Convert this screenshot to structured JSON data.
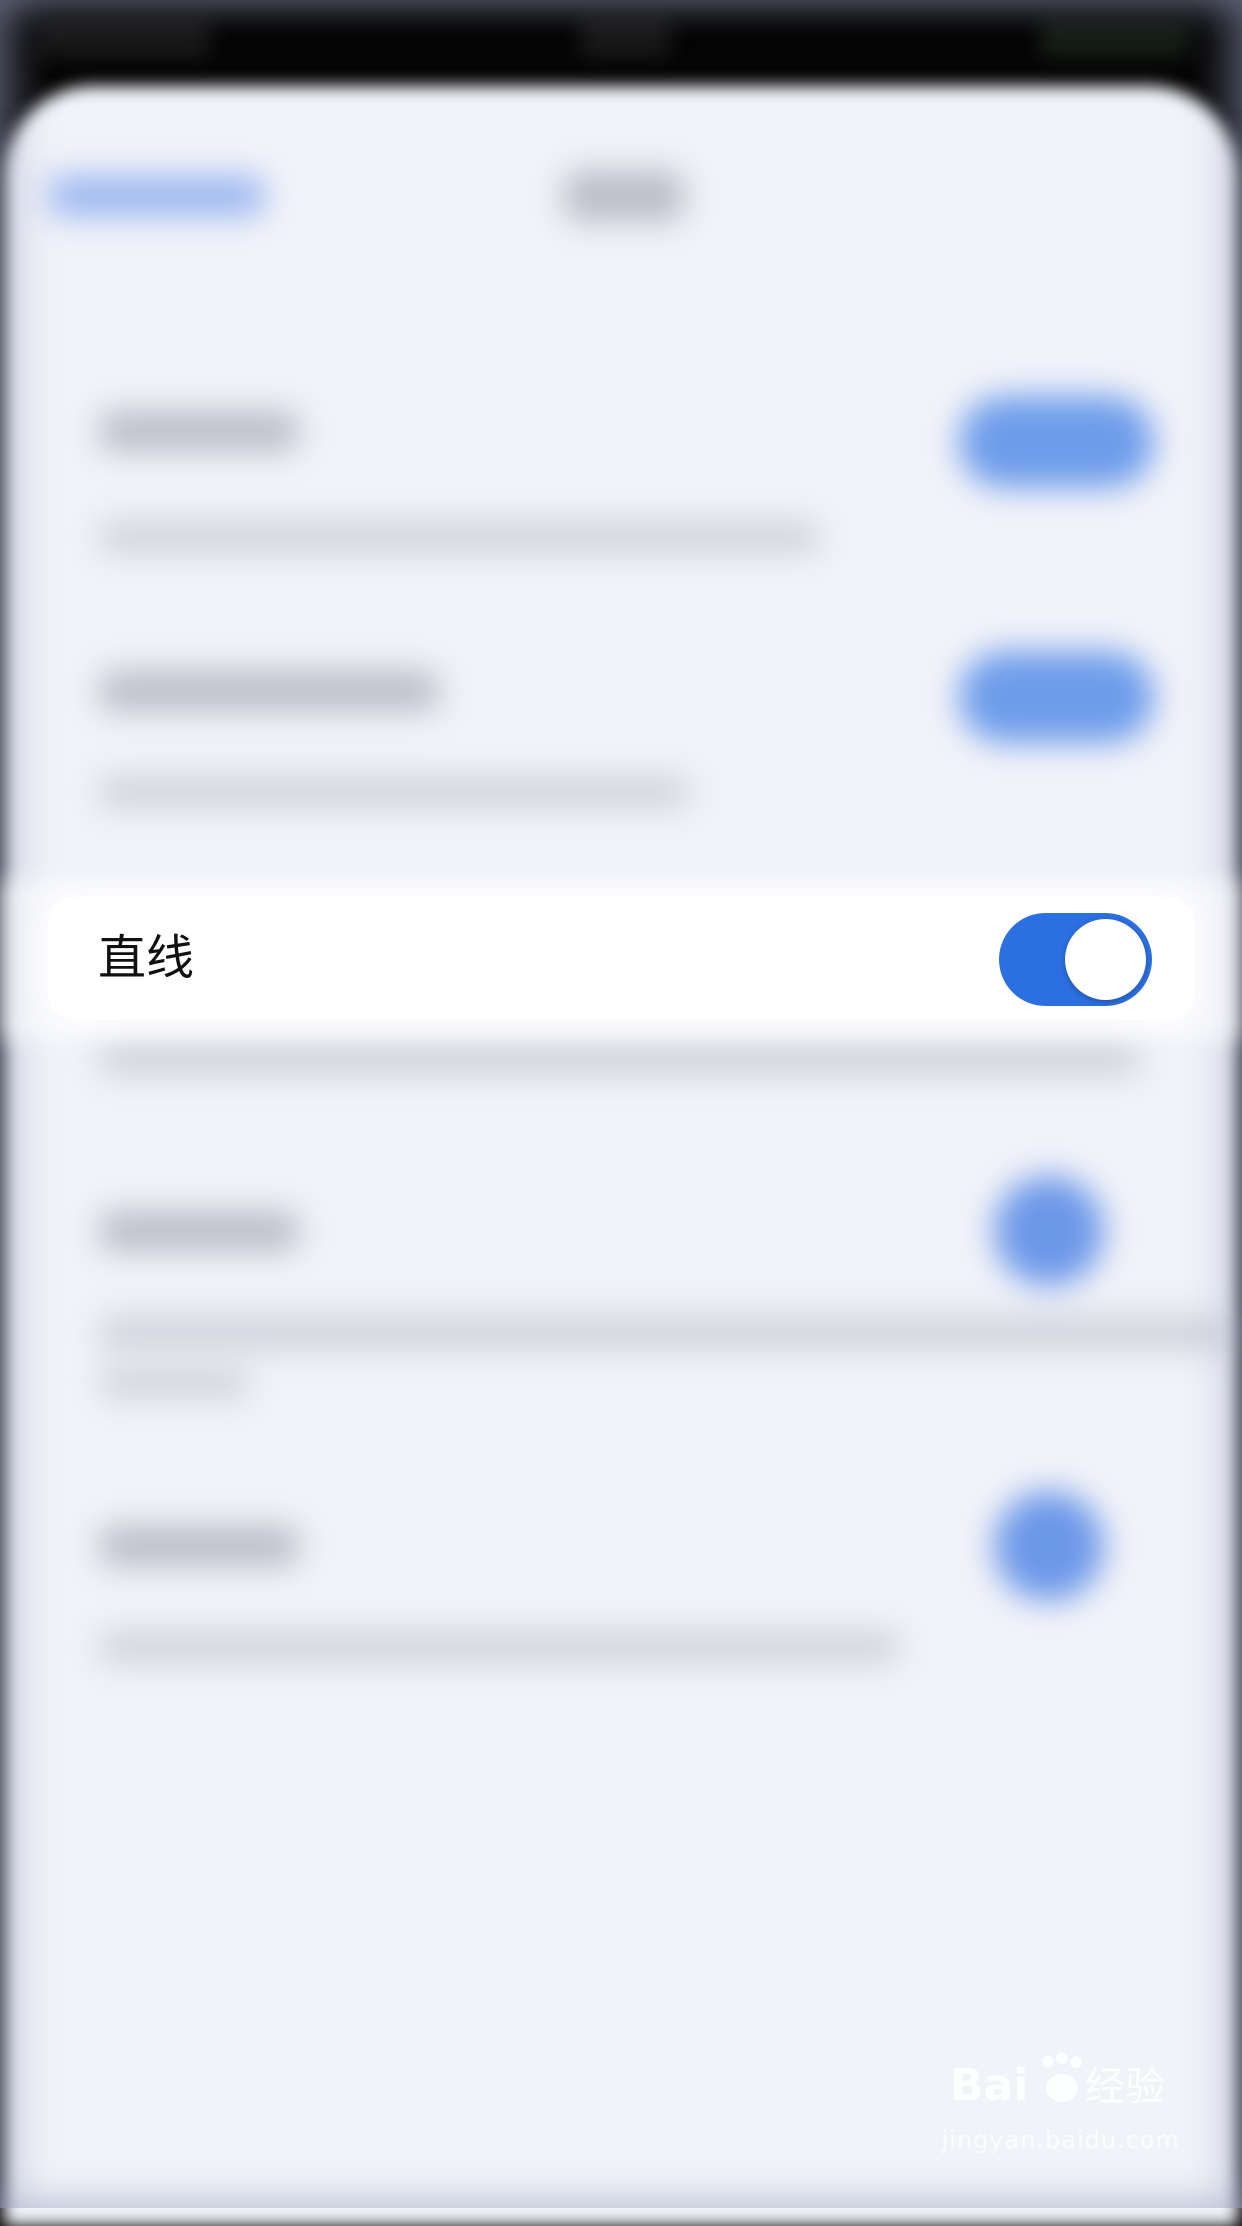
{
  "highlighted_row": {
    "label": "直线",
    "toggle_on": true,
    "toggle_color": "#2c6fe0"
  },
  "watermark": {
    "brand": "Baidu经验",
    "url": "jingyan.baidu.com"
  },
  "colors": {
    "sheet_background": "#f1f3f9",
    "accent_blue": "#6d9cea"
  }
}
